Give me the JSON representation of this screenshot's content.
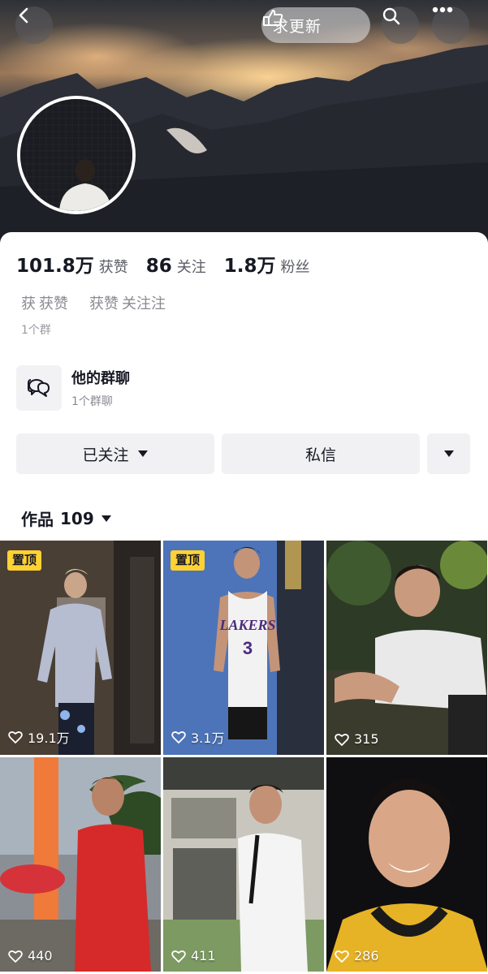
{
  "header": {
    "update_label": "求更新",
    "icons": [
      "back-arrow-icon",
      "hand-point-icon",
      "search-icon",
      "more-dots-icon"
    ]
  },
  "stats": {
    "likes_value": "101.8万",
    "likes_label": "获赞",
    "following_value": "86",
    "following_label": "关注",
    "followers_value": "1.8万",
    "followers_label": "粉丝"
  },
  "bio": {
    "line_a": "获",
    "line_b": "获赞",
    "line_c": "获赞",
    "line_d": "关注注",
    "group_count": "1个群"
  },
  "group_chat": {
    "title": "他的群聊",
    "subtitle": "1个群聊",
    "icon": "chat-bubbles-icon"
  },
  "actions": {
    "follow_label": "已关注",
    "message_label": "私信"
  },
  "works": {
    "label": "作品",
    "count": "109"
  },
  "videos": [
    {
      "pinned_label": "置顶",
      "likes": "19.1万"
    },
    {
      "pinned_label": "置顶",
      "likes": "3.1万"
    },
    {
      "pinned_label": "",
      "likes": "315"
    },
    {
      "pinned_label": "",
      "likes": "440"
    },
    {
      "pinned_label": "",
      "likes": "411"
    },
    {
      "pinned_label": "",
      "likes": "286"
    }
  ],
  "colors": {
    "pin_badge": "#ffd233",
    "text_primary": "#161823",
    "text_secondary": "#8a8b92",
    "button_bg": "#f1f1f3"
  }
}
